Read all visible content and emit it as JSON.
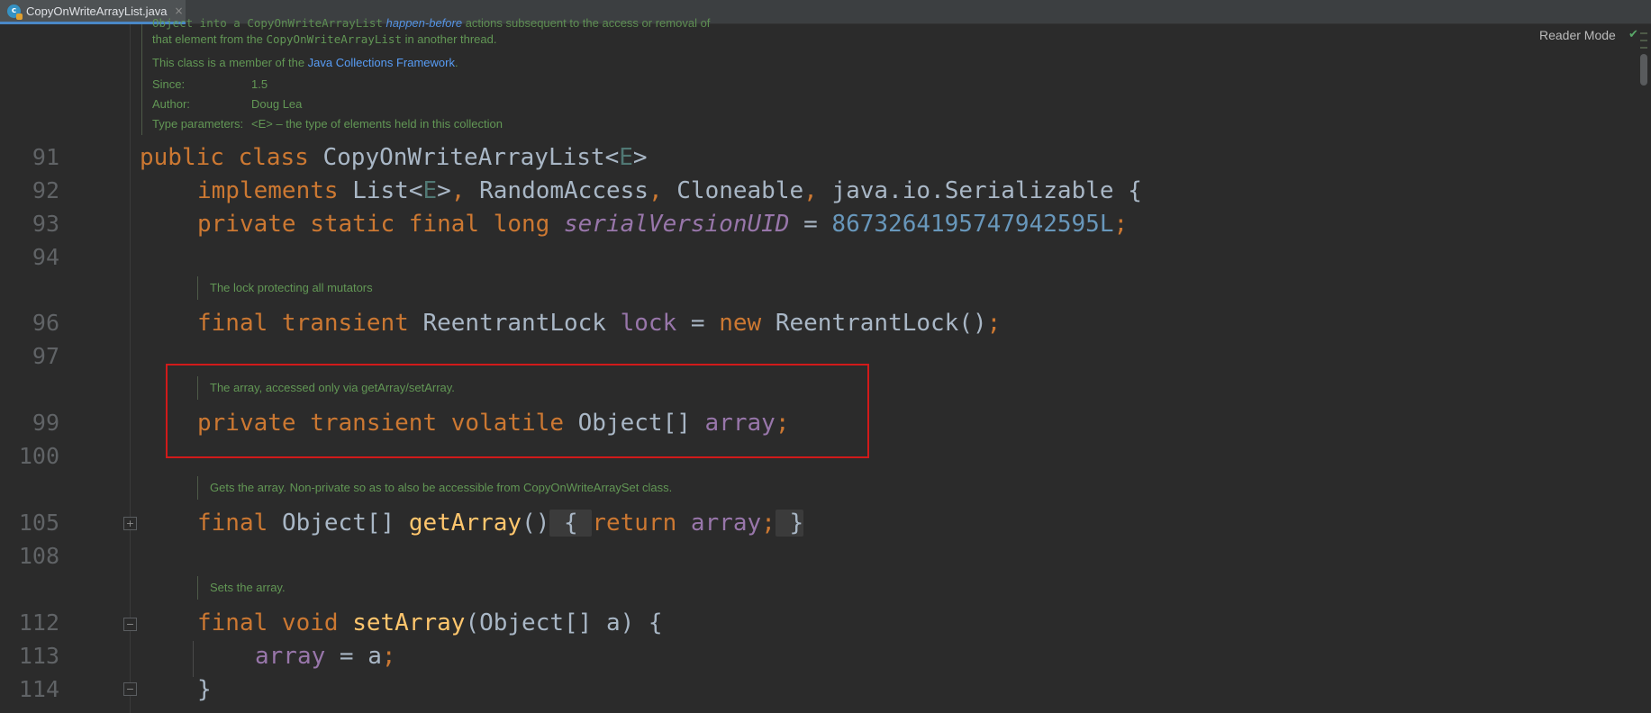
{
  "tab": {
    "file_name": "CopyOnWriteArrayList.java",
    "icon_letter": "c",
    "close_glyph": "×"
  },
  "reader_mode": {
    "label": "Reader Mode",
    "check": "✔"
  },
  "header_doc": {
    "line1_mono": "Object into a CopyOnWriteArrayList",
    "line1_link": "happen-before",
    "line1_rest": "actions subsequent to the access or removal of",
    "line2_pre": "that element from the ",
    "line2_mono": "CopyOnWriteArrayList",
    "line2_post": " in another thread.",
    "member_pre": "This class is a member of the ",
    "member_link": "Java Collections Framework",
    "member_post": ".",
    "since_label": "Since:",
    "since_value": "1.5",
    "author_label": "Author:",
    "author_value": "Doug Lea",
    "type_label": "Type parameters:",
    "type_value": "<E> – the type of elements held in this collection"
  },
  "line_numbers": [
    "91",
    "92",
    "93",
    "94",
    "96",
    "97",
    "99",
    "100",
    "105",
    "108",
    "112",
    "113",
    "114"
  ],
  "docs": {
    "lock": "The lock protecting all mutators",
    "array": "The array, accessed only via getArray/setArray.",
    "get_array": "Gets the array. Non-private so as to also be accessible from CopyOnWriteArraySet class.",
    "set_array": "Sets the array."
  },
  "code": {
    "l91": {
      "kw": "public class",
      "name": "CopyOnWriteArrayList",
      "lt": "<",
      "tp": "E",
      "gt": ">"
    },
    "l92": {
      "kw": "implements",
      "a": "List<",
      "tp": "E",
      "b": ">",
      "c1": ",",
      "b2": "RandomAccess",
      "c2": ",",
      "b3": "Cloneable",
      "c3": ",",
      "b4": "java.io.Serializable {"
    },
    "l93": {
      "kw": "private static final long",
      "field": "serialVersionUID",
      "eq": "=",
      "num": "8673264195747942595L",
      "semi": ";"
    },
    "l96": {
      "kw": "final transient",
      "type": "ReentrantLock",
      "field": "lock",
      "eq": "=",
      "kw2": "new",
      "call": "ReentrantLock()",
      "semi": ";"
    },
    "l99": {
      "kw": "private transient volatile",
      "type": "Object[]",
      "field": "array",
      "semi": ";"
    },
    "l105": {
      "kw": "final",
      "type": "Object[]",
      "fn": "getArray",
      "parens": "()",
      "open": " { ",
      "ret": "return",
      "field": "array",
      "semi": ";",
      "close": " }"
    },
    "l112": {
      "kw": "final void",
      "fn": "setArray",
      "params": "(Object[] a) {"
    },
    "l113": {
      "field": "array",
      "eq": " = a",
      "semi": ";"
    },
    "l114": {
      "brace": "}"
    }
  }
}
